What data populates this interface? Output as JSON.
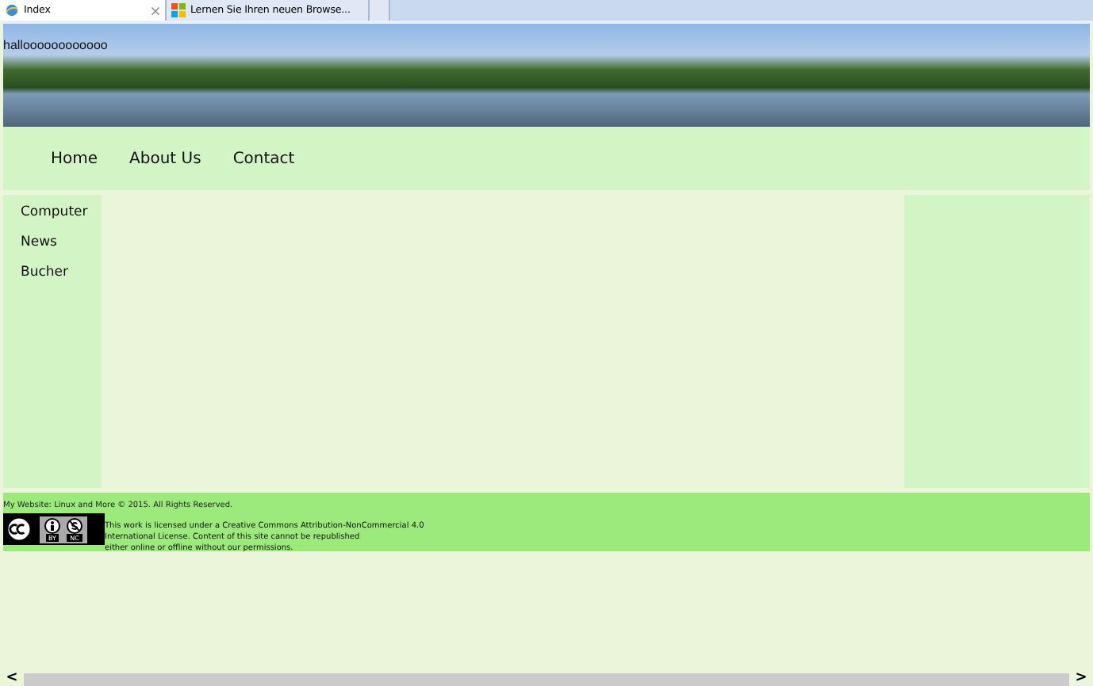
{
  "browser_tabs": [
    {
      "label": "Index",
      "selected": true,
      "closable": true
    },
    {
      "label": "Lernen Sie Ihren neuen Browse...",
      "selected": false,
      "closable": false
    }
  ],
  "banner": {
    "text": "halloooooooooooo"
  },
  "nav": [
    "Home",
    "About Us",
    "Contact"
  ],
  "sidebar": {
    "items": [
      "Computer",
      "News",
      "Bucher"
    ]
  },
  "footer": {
    "copyright": "My Website: Linux and More © 2015. All Rights Reserved.",
    "license_badge": {
      "by": "BY",
      "nc": "NC"
    },
    "license_lines": [
      "This work is licensed under a Creative Commons Attribution-NonCommercial 4.0",
      "International License. Content of this site cannot be republished",
      "either online or offline without our permissions."
    ]
  },
  "scrollbar": {
    "left": "<",
    "right": ">"
  }
}
